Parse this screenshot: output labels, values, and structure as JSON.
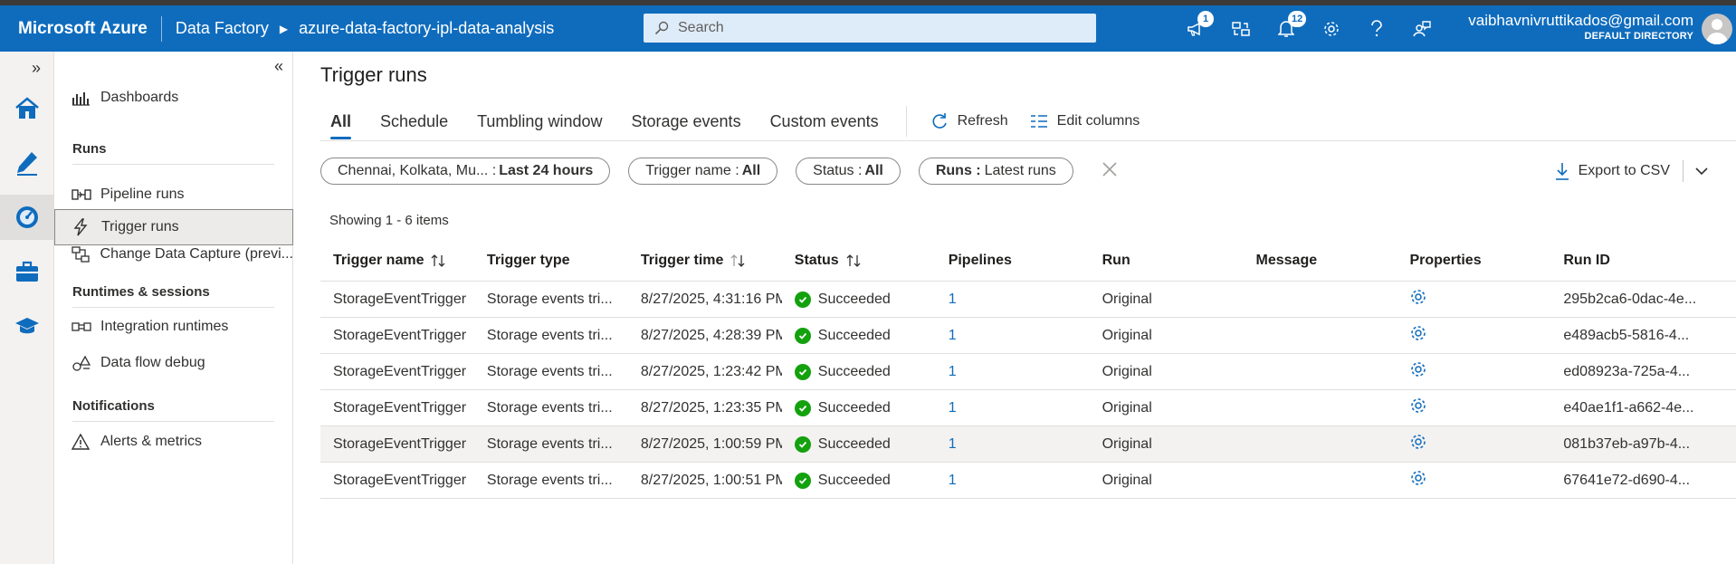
{
  "header": {
    "brand": "Microsoft Azure",
    "service": "Data Factory",
    "factory": "azure-data-factory-ipl-data-analysis",
    "search_placeholder": "Search",
    "badges": {
      "announcements": "1",
      "notifications": "12"
    },
    "account_email": "vaibhavnivruttikados@gmail.com",
    "account_directory": "DEFAULT DIRECTORY",
    "colors": {
      "bar": "#0f6cbd",
      "accent": "#0f6cbd",
      "success": "#13a10e"
    }
  },
  "rail": {
    "items": [
      "home-icon",
      "author-pencil-icon",
      "monitor-gauge-icon",
      "manage-toolbox-icon",
      "learning-hat-icon"
    ]
  },
  "sidenav": {
    "dashboards": "Dashboards",
    "section_runs": "Runs",
    "pipeline_runs": "Pipeline runs",
    "trigger_runs": "Trigger runs",
    "change_data_capture": "Change Data Capture (previ...",
    "section_runtimes": "Runtimes & sessions",
    "integration_runtimes": "Integration runtimes",
    "data_flow_debug": "Data flow debug",
    "section_notifications": "Notifications",
    "alerts_metrics": "Alerts & metrics"
  },
  "page": {
    "title": "Trigger runs",
    "tabs": [
      "All",
      "Schedule",
      "Tumbling window",
      "Storage events",
      "Custom events"
    ],
    "refresh_label": "Refresh",
    "edit_columns_label": "Edit columns",
    "filters": {
      "timezone_label": "Chennai, Kolkata, Mu... :",
      "timezone_value": "Last 24 hours",
      "trigger_name_label": "Trigger name :",
      "trigger_name_value": "All",
      "status_label": "Status :",
      "status_value": "All",
      "runs_label": "Runs :",
      "runs_value": "Latest runs"
    },
    "export_label": "Export to CSV",
    "showing": "Showing 1 - 6 items"
  },
  "table": {
    "columns": [
      "Trigger name",
      "Trigger type",
      "Trigger time",
      "Status",
      "Pipelines",
      "Run",
      "Message",
      "Properties",
      "Run ID"
    ],
    "rows": [
      {
        "name": "StorageEventTrigger",
        "type": "Storage events tri...",
        "time": "8/27/2025, 4:31:16 PM",
        "status": "Succeeded",
        "pipelines": "1",
        "run": "Original",
        "message": "",
        "run_id": "295b2ca6-0dac-4e..."
      },
      {
        "name": "StorageEventTrigger",
        "type": "Storage events tri...",
        "time": "8/27/2025, 4:28:39 PM",
        "status": "Succeeded",
        "pipelines": "1",
        "run": "Original",
        "message": "",
        "run_id": "e489acb5-5816-4..."
      },
      {
        "name": "StorageEventTrigger",
        "type": "Storage events tri...",
        "time": "8/27/2025, 1:23:42 PM",
        "status": "Succeeded",
        "pipelines": "1",
        "run": "Original",
        "message": "",
        "run_id": "ed08923a-725a-4..."
      },
      {
        "name": "StorageEventTrigger",
        "type": "Storage events tri...",
        "time": "8/27/2025, 1:23:35 PM",
        "status": "Succeeded",
        "pipelines": "1",
        "run": "Original",
        "message": "",
        "run_id": "e40ae1f1-a662-4e..."
      },
      {
        "name": "StorageEventTrigger",
        "type": "Storage events tri...",
        "time": "8/27/2025, 1:00:59 PM",
        "status": "Succeeded",
        "pipelines": "1",
        "run": "Original",
        "message": "",
        "run_id": "081b37eb-a97b-4..."
      },
      {
        "name": "StorageEventTrigger",
        "type": "Storage events tri...",
        "time": "8/27/2025, 1:00:51 PM",
        "status": "Succeeded",
        "pipelines": "1",
        "run": "Original",
        "message": "",
        "run_id": "67641e72-d690-4..."
      }
    ]
  }
}
